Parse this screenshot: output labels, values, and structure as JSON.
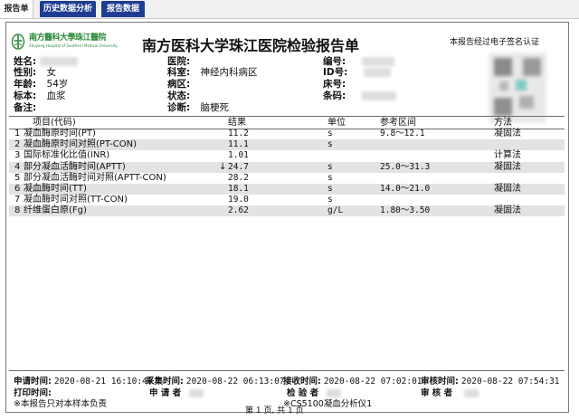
{
  "tabs": [
    {
      "label": "报告单",
      "active": true
    },
    {
      "label": "历史数据分析",
      "active": false
    },
    {
      "label": "报告数据",
      "active": false
    }
  ],
  "header": {
    "logo_text": "南方醫科大學珠江醫院",
    "logo_sub": "Zhujiang Hospital of Southern Medical University",
    "title": "南方医科大学珠江医院检验报告单",
    "signed_note": "本报告经过电子签名认证"
  },
  "patient": {
    "name_label": "姓名:",
    "gender_label": "性别:",
    "gender": "女",
    "age_label": "年龄:",
    "age": "54岁",
    "specimen_label": "标本:",
    "specimen": "血浆",
    "remark_label": "备注:",
    "hospital_label": "医院:",
    "dept_label": "科室:",
    "dept": "神经内科病区",
    "ward_label": "病区:",
    "status_label": "状态:",
    "diagnosis_label": "诊断:",
    "diagnosis": "脑梗死",
    "number_label": "编号:",
    "id_label": "ID号:",
    "bed_label": "床号:",
    "barcode_label": "条码:"
  },
  "table": {
    "headers": {
      "item": "项目(代码)",
      "result": "结果",
      "unit": "单位",
      "range": "参考区间",
      "method": "方法"
    },
    "rows": [
      {
        "no": "1",
        "name": "凝血酶原时间(PT)",
        "flag": "",
        "result": "11.2",
        "unit": "s",
        "range": "9.8～12.1",
        "method": "凝固法"
      },
      {
        "no": "2",
        "name": "凝血酶原时间对照(PT-CON)",
        "flag": "",
        "result": "11.1",
        "unit": "s",
        "range": "",
        "method": ""
      },
      {
        "no": "3",
        "name": "国际标准化比值(INR)",
        "flag": "",
        "result": "1.01",
        "unit": "",
        "range": "",
        "method": "计算法"
      },
      {
        "no": "4",
        "name": "部分凝血活酶时间(APTT)",
        "flag": "↓",
        "result": "24.7",
        "unit": "s",
        "range": "25.0～31.3",
        "method": "凝固法"
      },
      {
        "no": "5",
        "name": "部分凝血活酶时间对照(APTT-CON)",
        "flag": "",
        "result": "28.2",
        "unit": "s",
        "range": "",
        "method": ""
      },
      {
        "no": "6",
        "name": "凝血酶时间(TT)",
        "flag": "",
        "result": "18.1",
        "unit": "s",
        "range": "14.0～21.0",
        "method": "凝固法"
      },
      {
        "no": "7",
        "name": "凝血酶时间对照(TT-CON)",
        "flag": "",
        "result": "19.0",
        "unit": "s",
        "range": "",
        "method": ""
      },
      {
        "no": "8",
        "name": "纤维蛋白原(Fg)",
        "flag": "",
        "result": "2.62",
        "unit": "g/L",
        "range": "1.80～3.50",
        "method": "凝固法"
      }
    ]
  },
  "footer": {
    "apply_time_label": "申请时间:",
    "apply_time": "2020-08-21 16:10:40",
    "collect_time_label": "采集时间:",
    "collect_time": "2020-08-22 06:13:07",
    "receive_time_label": "接收时间:",
    "receive_time": "2020-08-22 07:02:01",
    "review_time_label": "审核时间:",
    "review_time": "2020-08-22 07:54:31",
    "print_time_label": "打印时间:",
    "applicant_label": "申 请 者",
    "tester_label": "检 验 者",
    "reviewer_label": "审 核 者",
    "disclaimer": "※本报告只对本样本负责",
    "instrument": "※CS5100凝血分析仪1",
    "page": "第 1 页, 共 1 页"
  }
}
